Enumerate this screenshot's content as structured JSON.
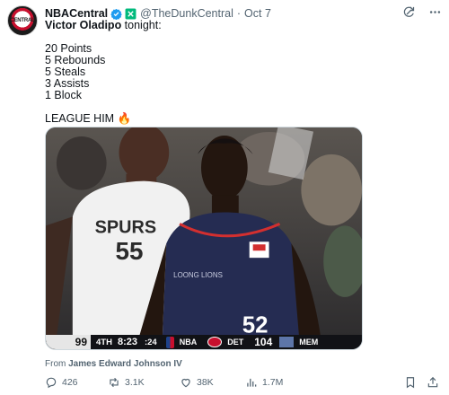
{
  "author": {
    "display_name": "NBACentral",
    "handle": "@TheDunkCentral",
    "time": "Oct 7",
    "avatar_text": "CENTRAL"
  },
  "tweet": {
    "mention": "Victor Oladipo",
    "intro_rest": " tonight:",
    "stats": [
      "20 Points",
      "5 Rebounds",
      "5 Steals",
      "3 Assists",
      "1 Block"
    ],
    "closing": "LEAGUE HIM 🔥"
  },
  "scoreboard": {
    "home_score": "99",
    "quarter": "4TH",
    "clock": "8:23",
    "shot_clock": ":24",
    "network": "NBA",
    "away_team": "DET",
    "away_score": "104",
    "third_team": "MEM"
  },
  "jerseys": {
    "left_team": "SPURS",
    "left_number": "55",
    "right_team": "LOONG LIONS",
    "right_number": "52"
  },
  "attribution": {
    "prefix": "From ",
    "name": "James Edward Johnson IV"
  },
  "metrics": {
    "replies": "426",
    "reposts": "3.1K",
    "likes": "38K",
    "views": "1.7M"
  },
  "icons": {
    "verified": "verified-badge-icon",
    "affiliate": "affiliate-badge-icon",
    "grok": "grok-icon",
    "more": "more-icon",
    "reply": "reply-icon",
    "repost": "repost-icon",
    "like": "like-icon",
    "views": "views-icon",
    "bookmark": "bookmark-icon",
    "share": "share-icon"
  },
  "colors": {
    "verified": "#1d9bf0",
    "affiliate": "#00ba7c",
    "text": "#0f1419",
    "muted": "#536471"
  }
}
